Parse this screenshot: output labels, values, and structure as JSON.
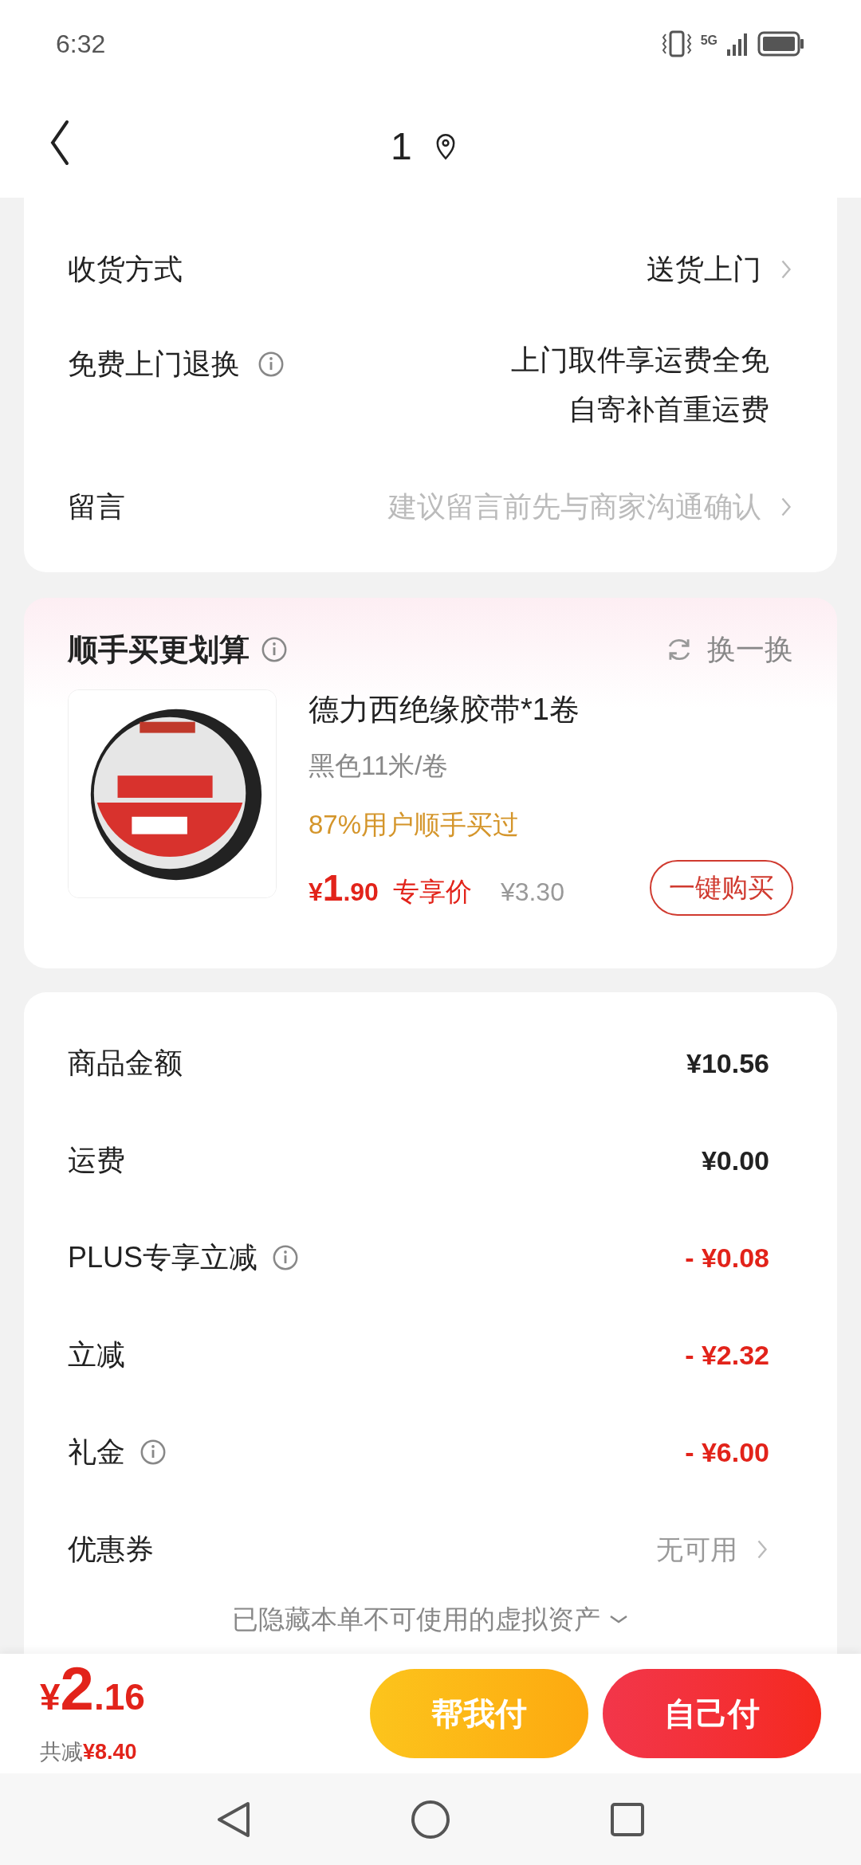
{
  "status_bar": {
    "time": "6:32",
    "network": "5G"
  },
  "header": {
    "title": "1"
  },
  "delivery": [
    {
      "kind": "select",
      "label": "收货方式",
      "value": "送货上门"
    },
    {
      "kind": "info",
      "label": "免费上门退换",
      "value_lines": [
        "上门取件享运费全免",
        "自寄补首重运费"
      ]
    },
    {
      "kind": "note",
      "label": "留言",
      "placeholder": "建议留言前先与商家沟通确认"
    }
  ],
  "addon": {
    "title": "顺手买更划算",
    "refresh": "换一换",
    "product": {
      "name": "德力西绝缘胶带*1卷",
      "spec": "黑色11米/卷",
      "social": "87%用户顺手买过",
      "price_symbol": "¥",
      "price_int": "1",
      "price_dec": ".90",
      "price_tag": "专享价",
      "original_price": "¥3.30",
      "buy_button": "一键购买"
    }
  },
  "summary": [
    {
      "kind": "amount",
      "label": "商品金额",
      "info": false,
      "value": "¥10.56"
    },
    {
      "kind": "amount",
      "label": "运费",
      "info": false,
      "value": "¥0.00"
    },
    {
      "kind": "discount",
      "label": "PLUS专享立减",
      "info": true,
      "value": "- ¥0.08"
    },
    {
      "kind": "discount",
      "label": "立减",
      "info": false,
      "value": "- ¥2.32"
    },
    {
      "kind": "discount",
      "label": "礼金",
      "info": true,
      "value": "- ¥6.00"
    },
    {
      "kind": "link",
      "label": "优惠券",
      "info": false,
      "value": "无可用"
    }
  ],
  "hidden_note": "已隐藏本单不可使用的虚拟资产",
  "bottom_bar": {
    "price_symbol": "¥",
    "price_int": "2",
    "price_dec": ".16",
    "saved_label": "共减",
    "saved": "¥8.40",
    "buttons": [
      {
        "kind": "friend",
        "label": "帮我付"
      },
      {
        "kind": "self",
        "label": "自己付"
      }
    ]
  }
}
